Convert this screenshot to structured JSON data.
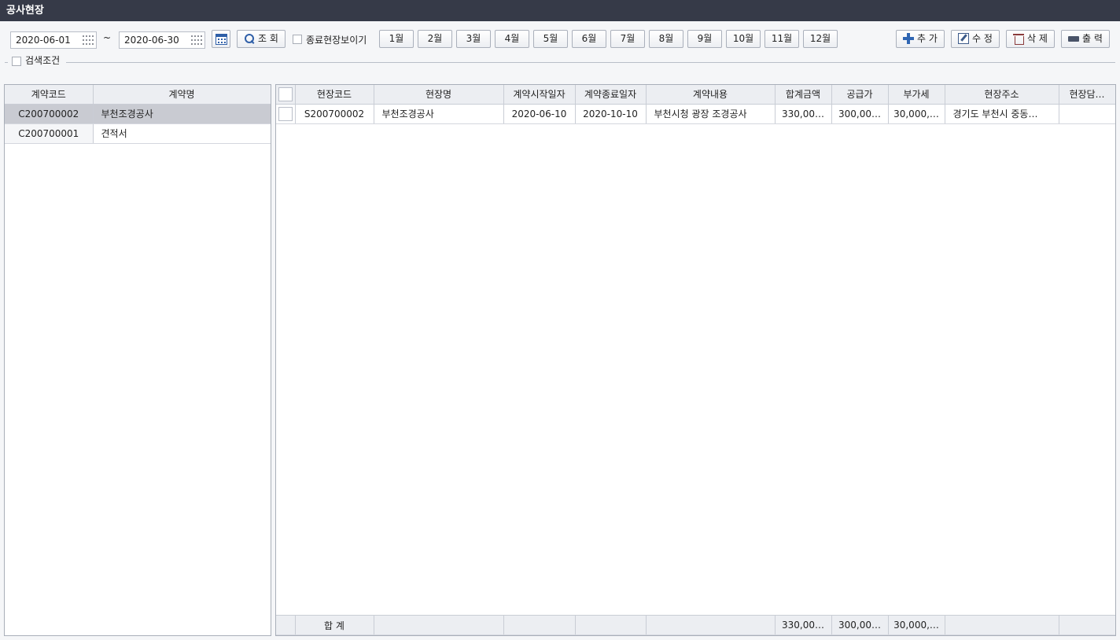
{
  "window": {
    "title": "공사현장"
  },
  "search": {
    "date_from": "2020-06-01",
    "date_to": "2020-06-30",
    "tilde": "~",
    "query_label": "조 회",
    "show_closed_label": "종료현장보이기",
    "months": [
      "1월",
      "2월",
      "3월",
      "4월",
      "5월",
      "6월",
      "7월",
      "8월",
      "9월",
      "10월",
      "11월",
      "12월"
    ],
    "conditions_label": "검색조건"
  },
  "actions": {
    "add": "추 가",
    "edit": "수 정",
    "delete": "삭 제",
    "print": "출 력"
  },
  "contracts": {
    "columns": [
      "계약코드",
      "계약명"
    ],
    "rows": [
      {
        "code": "C200700002",
        "name": "부천조경공사"
      },
      {
        "code": "C200700001",
        "name": "견적서"
      }
    ]
  },
  "sites": {
    "columns": [
      "현장코드",
      "현장명",
      "계약시작일자",
      "계약종료일자",
      "계약내용",
      "합계금액",
      "공급가",
      "부가세",
      "현장주소",
      "현장담…"
    ],
    "rows": [
      {
        "code": "S200700002",
        "name": "부천조경공사",
        "start": "2020-06-10",
        "end": "2020-10-10",
        "content": "부천시청 광장 조경공사",
        "total": "330,00…",
        "supply": "300,00…",
        "vat": "30,000,…",
        "address": "경기도 부천시 중동…",
        "manager": ""
      }
    ],
    "footer": {
      "label": "합 계",
      "total": "330,00…",
      "supply": "300,00…",
      "vat": "30,000,…"
    }
  }
}
